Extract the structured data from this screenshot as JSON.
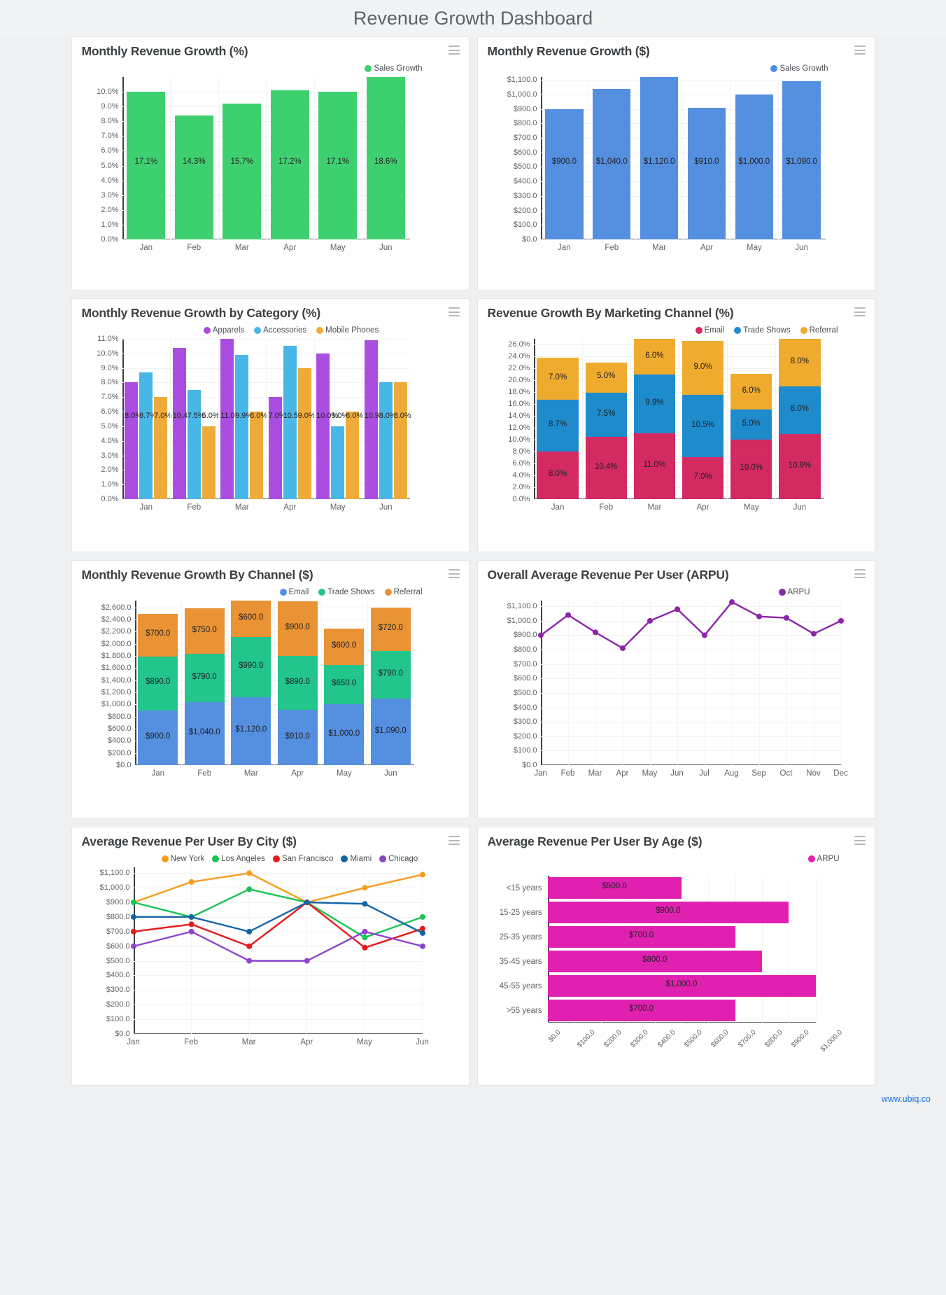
{
  "header": {
    "title": "Revenue Growth Dashboard"
  },
  "footer": {
    "link": "www.ubiq.co"
  },
  "menu_icon": "hamburger-menu-icon",
  "cards": [
    {
      "title": "Monthly Revenue Growth (%)"
    },
    {
      "title": "Monthly Revenue Growth ($)"
    },
    {
      "title": "Monthly Revenue Growth by Category (%)"
    },
    {
      "title": "Revenue Growth By Marketing Channel (%)"
    },
    {
      "title": "Monthly Revenue Growth By Channel ($)"
    },
    {
      "title": "Overall Average Revenue Per User (ARPU)"
    },
    {
      "title": "Average Revenue Per User By City ($)"
    },
    {
      "title": "Average Revenue Per User By Age ($)"
    }
  ],
  "chart_data": [
    {
      "id": "monthly-growth-pct",
      "type": "bar",
      "title": "Monthly Revenue Growth (%)",
      "categories": [
        "Jan",
        "Feb",
        "Mar",
        "Apr",
        "May",
        "Jun"
      ],
      "series": [
        {
          "name": "Sales Growth",
          "color": "#3ed06e",
          "values": [
            10.0,
            8.4,
            9.2,
            10.1,
            10.0,
            11.0
          ],
          "labels": [
            "17.1%",
            "14.3%",
            "15.7%",
            "17.2%",
            "17.1%",
            "18.6%"
          ]
        }
      ],
      "ylabel": "",
      "xlabel": "",
      "yticks": [
        "0.0%",
        "1.0%",
        "2.0%",
        "3.0%",
        "4.0%",
        "5.0%",
        "6.0%",
        "7.0%",
        "8.0%",
        "9.0%",
        "10.0%"
      ],
      "ylim": [
        0,
        11.0
      ],
      "legend": [
        "Sales Growth"
      ],
      "legend_position": "top-right",
      "grid": true
    },
    {
      "id": "monthly-growth-usd",
      "type": "bar",
      "title": "Monthly Revenue Growth ($)",
      "categories": [
        "Jan",
        "Feb",
        "Mar",
        "Apr",
        "May",
        "Jun"
      ],
      "series": [
        {
          "name": "Sales Growth",
          "color": "#558fe0",
          "values": [
            900,
            1040,
            1120,
            910,
            1000,
            1090
          ],
          "labels": [
            "$900.0",
            "$1,040.0",
            "$1,120.0",
            "$910.0",
            "$1,000.0",
            "$1,090.0"
          ]
        }
      ],
      "yticks": [
        "$0.0",
        "$100.0",
        "$200.0",
        "$300.0",
        "$400.0",
        "$500.0",
        "$600.0",
        "$700.0",
        "$800.0",
        "$900.0",
        "$1,000.0",
        "$1,100.0"
      ],
      "ylim": [
        0,
        1120
      ],
      "legend": [
        "Sales Growth"
      ],
      "legend_position": "top-right",
      "grid": true
    },
    {
      "id": "growth-by-category",
      "type": "bar",
      "title": "Monthly Revenue Growth by Category (%)",
      "categories": [
        "Jan",
        "Feb",
        "Mar",
        "Apr",
        "May",
        "Jun"
      ],
      "series": [
        {
          "name": "Apparels",
          "color": "#a94ee0",
          "values": [
            8.0,
            10.4,
            11.0,
            7.0,
            10.0,
            10.9
          ],
          "labels": [
            "8.0%",
            "10.4",
            "11.0",
            "7.0%",
            "10.0%",
            "10.9"
          ]
        },
        {
          "name": "Accessories",
          "color": "#49b6e8",
          "values": [
            8.7,
            7.5,
            9.9,
            10.5,
            5.0,
            8.0
          ],
          "labels": [
            "8.7%",
            "7.5%",
            "9.9%",
            "10.5",
            "5.0%",
            "8.0%"
          ]
        },
        {
          "name": "Mobile Phones",
          "color": "#efab3a",
          "values": [
            7.0,
            5.0,
            6.0,
            9.0,
            6.0,
            8.0
          ],
          "labels": [
            "7.0%",
            "5.0%",
            "6.0%",
            "9.0%",
            "6.0%",
            "8.0%"
          ]
        }
      ],
      "yticks": [
        "0.0%",
        "1.0%",
        "2.0%",
        "3.0%",
        "4.0%",
        "5.0%",
        "6.0%",
        "7.0%",
        "8.0%",
        "9.0%",
        "10.0%",
        "11.0%"
      ],
      "ylim": [
        0,
        11.0
      ],
      "legend": [
        "Apparels",
        "Accessories",
        "Mobile Phones"
      ],
      "legend_position": "top-center",
      "grid": true
    },
    {
      "id": "growth-by-marketing-channel",
      "type": "bar",
      "stacked": true,
      "title": "Revenue Growth By Marketing Channel (%)",
      "categories": [
        "Jan",
        "Feb",
        "Mar",
        "Apr",
        "May",
        "Jun"
      ],
      "series": [
        {
          "name": "Email",
          "color": "#d32a62",
          "values": [
            8.0,
            10.4,
            11.0,
            7.0,
            10.0,
            10.9
          ],
          "labels": [
            "8.0%",
            "10.4%",
            "11.0%",
            "7.0%",
            "10.0%",
            "10.9%"
          ]
        },
        {
          "name": "Trade Shows",
          "color": "#1e8bcd",
          "values": [
            8.7,
            7.5,
            9.9,
            10.5,
            5.0,
            8.0
          ],
          "labels": [
            "8.7%",
            "7.5%",
            "9.9%",
            "10.5%",
            "5.0%",
            "8.0%"
          ]
        },
        {
          "name": "Referral",
          "color": "#efab2e",
          "values": [
            7.0,
            5.0,
            6.0,
            9.0,
            6.0,
            8.0
          ],
          "labels": [
            "7.0%",
            "5.0%",
            "6.0%",
            "9.0%",
            "6.0%",
            "8.0%"
          ]
        }
      ],
      "yticks": [
        "0.0%",
        "2.0%",
        "4.0%",
        "6.0%",
        "8.0%",
        "10.0%",
        "12.0%",
        "14.0%",
        "16.0%",
        "18.0%",
        "20.0%",
        "22.0%",
        "24.0%",
        "26.0%"
      ],
      "ylim": [
        0,
        26.9
      ],
      "legend": [
        "Email",
        "Trade Shows",
        "Referral"
      ],
      "legend_position": "top-right",
      "grid": true
    },
    {
      "id": "growth-by-channel-usd",
      "type": "bar",
      "stacked": true,
      "title": "Monthly Revenue Growth By Channel ($)",
      "categories": [
        "Jan",
        "Feb",
        "Mar",
        "Apr",
        "May",
        "Jun"
      ],
      "series": [
        {
          "name": "Email",
          "color": "#558fe0",
          "values": [
            900,
            1040,
            1120,
            910,
            1000,
            1090
          ],
          "labels": [
            "$900.0",
            "$1,040.0",
            "$1,120.0",
            "$910.0",
            "$1,000.0",
            "$1,090.0"
          ]
        },
        {
          "name": "Trade Shows",
          "color": "#22c58b",
          "values": [
            890,
            790,
            990,
            890,
            650,
            790
          ],
          "labels": [
            "$890.0",
            "$790.0",
            "$990.0",
            "$890.0",
            "$650.0",
            "$790.0"
          ]
        },
        {
          "name": "Referral",
          "color": "#ea9335",
          "values": [
            700,
            750,
            600,
            900,
            600,
            720
          ],
          "labels": [
            "$700.0",
            "$750.0",
            "$600.0",
            "$900.0",
            "$600.0",
            "$720.0"
          ]
        }
      ],
      "yticks": [
        "$0.0",
        "$200.0",
        "$400.0",
        "$600.0",
        "$800.0",
        "$1,000.0",
        "$1,200.0",
        "$1,400.0",
        "$1,600.0",
        "$1,800.0",
        "$2,000.0",
        "$2,200.0",
        "$2,400.0",
        "$2,600.0"
      ],
      "ylim": [
        0,
        2710
      ],
      "legend": [
        "Email",
        "Trade Shows",
        "Referral"
      ],
      "legend_position": "top-right",
      "grid": true
    },
    {
      "id": "overall-arpu",
      "type": "line",
      "title": "Overall Average Revenue Per User (ARPU)",
      "categories": [
        "Jan",
        "Feb",
        "Mar",
        "Apr",
        "May",
        "Jun",
        "Jul",
        "Aug",
        "Sep",
        "Oct",
        "Nov",
        "Dec"
      ],
      "series": [
        {
          "name": "ARPU",
          "color": "#8e24aa",
          "values": [
            900,
            1040,
            920,
            810,
            1000,
            1080,
            900,
            1130,
            1030,
            1020,
            910,
            1000
          ]
        }
      ],
      "yticks": [
        "$0.0",
        "$100.0",
        "$200.0",
        "$300.0",
        "$400.0",
        "$500.0",
        "$600.0",
        "$700.0",
        "$800.0",
        "$900.0",
        "$1,000.0",
        "$1,100.0"
      ],
      "ylim": [
        0,
        1140
      ],
      "legend": [
        "ARPU"
      ],
      "legend_position": "top-right",
      "grid": true
    },
    {
      "id": "arpu-by-city",
      "type": "line",
      "title": "Average Revenue Per User By City ($)",
      "categories": [
        "Jan",
        "Feb",
        "Mar",
        "Apr",
        "May",
        "Jun"
      ],
      "series": [
        {
          "name": "New York",
          "color": "#f79c1e",
          "values": [
            900,
            1040,
            1100,
            900,
            1000,
            1090
          ]
        },
        {
          "name": "Los Angeles",
          "color": "#18c452",
          "values": [
            900,
            800,
            990,
            900,
            660,
            800
          ]
        },
        {
          "name": "San Francisco",
          "color": "#e51b1b",
          "values": [
            700,
            750,
            600,
            900,
            590,
            720
          ]
        },
        {
          "name": "Miami",
          "color": "#1464a5",
          "values": [
            800,
            800,
            700,
            900,
            890,
            690
          ]
        },
        {
          "name": "Chicago",
          "color": "#8e44d0",
          "values": [
            600,
            700,
            500,
            500,
            700,
            600
          ]
        }
      ],
      "yticks": [
        "$0.0",
        "$100.0",
        "$200.0",
        "$300.0",
        "$400.0",
        "$500.0",
        "$600.0",
        "$700.0",
        "$800.0",
        "$900.0",
        "$1,000.0",
        "$1,100.0"
      ],
      "ylim": [
        0,
        1140
      ],
      "legend": [
        "New York",
        "Los Angeles",
        "San Francisco",
        "Miami",
        "Chicago"
      ],
      "legend_position": "top-center",
      "grid": true
    },
    {
      "id": "arpu-by-age",
      "type": "bar",
      "orientation": "horizontal",
      "title": "Average Revenue Per User By Age ($)",
      "categories": [
        "<15 years",
        "15-25 years",
        "25-35 years",
        "35-45 years",
        "45-55 years",
        ">55 years"
      ],
      "series": [
        {
          "name": "ARPU",
          "color": "#e021b0",
          "values": [
            500,
            900,
            700,
            800,
            1000,
            700
          ],
          "labels": [
            "$500.0",
            "$900.0",
            "$700.0",
            "$800.0",
            "$1,000.0",
            "$700.0"
          ]
        }
      ],
      "xticks": [
        "$0.0",
        "$100.0",
        "$200.0",
        "$300.0",
        "$400.0",
        "$500.0",
        "$600.0",
        "$700.0",
        "$800.0",
        "$900.0",
        "$1,000.0"
      ],
      "xlim": [
        0,
        1000
      ],
      "legend": [
        "ARPU"
      ],
      "legend_position": "top-right",
      "grid": true
    }
  ]
}
